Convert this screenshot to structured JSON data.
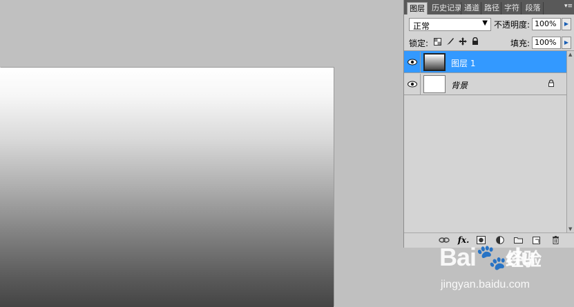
{
  "panel": {
    "tabs": [
      "图层",
      "历史记录",
      "通道",
      "路径",
      "字符",
      "段落"
    ],
    "menu_glyph": "▾≡",
    "blend_mode": "正常",
    "opacity_label": "不透明度:",
    "opacity_value": "100%",
    "lock_label": "锁定:",
    "fill_label": "填充:",
    "fill_value": "100%",
    "layers": [
      {
        "name": "图层 1",
        "visible": true,
        "selected": true,
        "thumbnail": "gradient"
      },
      {
        "name": "背景",
        "visible": true,
        "selected": false,
        "thumbnail": "white",
        "locked": true
      }
    ],
    "footer_fx": "fx."
  },
  "watermark": {
    "logo": "Bai",
    "logo_rest": "du",
    "service": "经验",
    "url": "jingyan.baidu.com"
  },
  "colors": {
    "selection": "#3399ff",
    "workspace": "#c0c0c0",
    "panel": "#d4d4d4"
  }
}
